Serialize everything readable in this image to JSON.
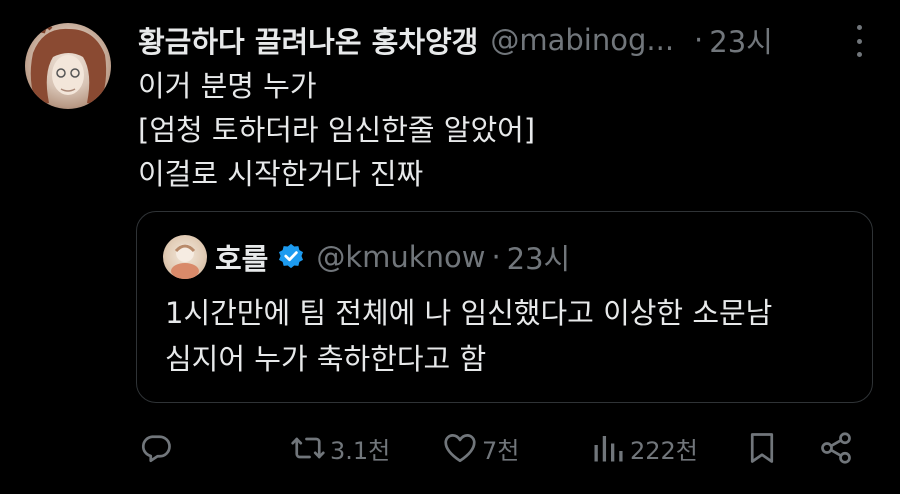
{
  "tweet": {
    "author_name": "황금하다 끌려나온 홍차양갱",
    "author_handle": "@mabinog...",
    "separator": "·",
    "time": "23시",
    "lines": [
      "이거 분명 누가",
      "[엄청 토하더라 임신한줄 알았어]",
      "이걸로 시작한거다 진짜"
    ]
  },
  "quote": {
    "author_name": "호롤",
    "author_handle": "@kmuknow",
    "separator": "·",
    "time": "23시",
    "lines": [
      "1시간만에 팀 전체에 나 임신했다고 이상한 소문남",
      "심지어 누가 축하한다고 함"
    ]
  },
  "actions": {
    "reply_icon": "reply-icon",
    "retweet_icon": "retweet-icon",
    "retweet_count": "3.1천",
    "like_icon": "heart-icon",
    "like_count": "7천",
    "views_icon": "views-icon",
    "views_count": "222천",
    "bookmark_icon": "bookmark-icon",
    "share_icon": "share-icon"
  },
  "colors": {
    "background": "#000000",
    "text": "#e7e9ea",
    "muted": "#71767b",
    "border": "#2f3336",
    "verified": "#1d9bf0"
  }
}
